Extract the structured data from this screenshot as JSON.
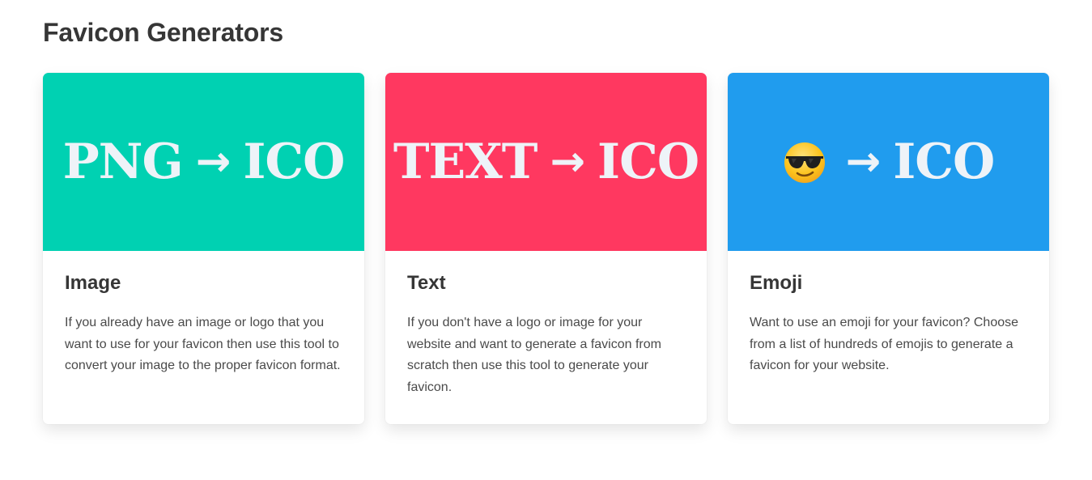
{
  "page": {
    "title": "Favicon Generators"
  },
  "colors": {
    "image_banner": "#00d1b2",
    "text_banner": "#ff3860",
    "emoji_banner": "#209cee",
    "banner_text": "#eef3f8"
  },
  "cards": [
    {
      "banner_left": "PNG",
      "arrow": "→",
      "banner_right": "ICO",
      "title": "Image",
      "description": "If you already have an image or logo that you want to use for your favicon then use this tool to convert your image to the proper favicon format."
    },
    {
      "banner_left": "TEXT",
      "arrow": "→",
      "banner_right": "ICO",
      "title": "Text",
      "description": "If you don't have a logo or image for your website and want to generate a favicon from scratch then use this tool to generate your favicon."
    },
    {
      "banner_icon": "sunglasses-emoji-icon",
      "arrow": "→",
      "banner_right": "ICO",
      "title": "Emoji",
      "description": "Want to use an emoji for your favicon? Choose from a list of hundreds of emojis to generate a favicon for your website."
    }
  ]
}
